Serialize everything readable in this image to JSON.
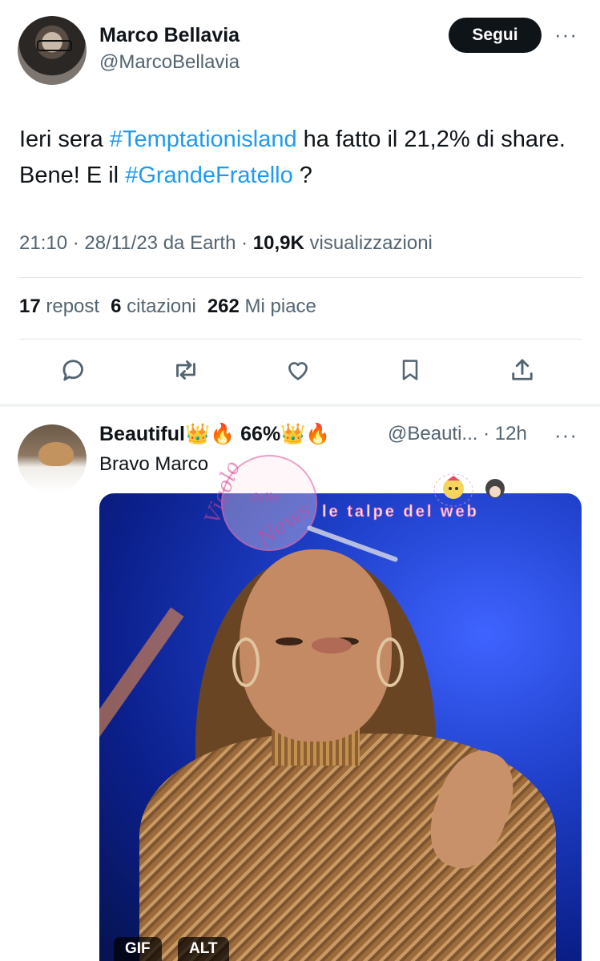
{
  "tweet": {
    "author": {
      "display_name": "Marco Bellavia",
      "handle": "@MarcoBellavia"
    },
    "follow_label": "Segui",
    "more_label": "···",
    "text": {
      "p1": "Ieri sera ",
      "hashtag1": "#Temptationisland",
      "p2": " ha fatto il 21,2% di share.  Bene! E il ",
      "hashtag2": "#GrandeFratello",
      "p3": " ?"
    },
    "meta": {
      "time": "21:10",
      "sep1": " · ",
      "date": "28/11/23",
      "source": " da Earth",
      "sep2": " · ",
      "views": "10,9K",
      "views_label": " visualizzazioni"
    },
    "stats": {
      "reposts": "17",
      "reposts_label": " repost",
      "quotes": "6",
      "quotes_label": " citazioni",
      "likes": "262",
      "likes_label": " Mi piace"
    },
    "actions": [
      {
        "name": "reply-icon"
      },
      {
        "name": "repost-icon"
      },
      {
        "name": "like-icon"
      },
      {
        "name": "bookmark-icon"
      },
      {
        "name": "share-icon"
      }
    ]
  },
  "reply": {
    "display_name": "Beautiful👑🔥 66%👑🔥",
    "handle": "@Beauti...",
    "time": "· 12h",
    "more_label": "···",
    "text": "Bravo Marco",
    "media": {
      "gif_badge": "GIF",
      "alt_badge": "ALT"
    }
  },
  "watermarks": {
    "circle_line1": "Vicolo",
    "circle_line2": "delle",
    "circle_line3": "News",
    "banner": "le talpe del web"
  },
  "colors": {
    "link": "#1d9bf0",
    "text": "#0f1419",
    "secondary": "#536471",
    "button": "#0f1419"
  }
}
